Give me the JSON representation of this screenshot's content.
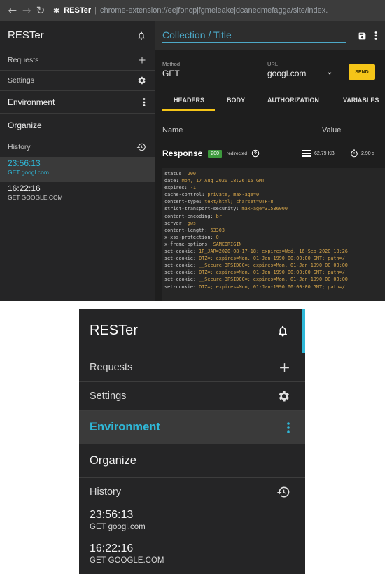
{
  "browser": {
    "back_icon": "arrow-left-icon",
    "forward_icon": "arrow-right-icon",
    "reload_icon": "reload-icon",
    "extension_icon": "puzzle-icon",
    "site_name": "RESTer",
    "url": "chrome-extension://eejfoncpjfgmeleakejdcanedmefagga/site/index."
  },
  "sidebar": {
    "title": "RESTer",
    "title_icon": "bell-icon",
    "requests_label": "Requests",
    "settings_label": "Settings",
    "environment_label": "Environment",
    "organize_label": "Organize",
    "history_label": "History",
    "history": [
      {
        "time": "23:56:13",
        "request": "GET googl.com"
      },
      {
        "time": "16:22:16",
        "request": "GET GOOGLE.COM"
      }
    ]
  },
  "request": {
    "collection_placeholder": "Collection / Title",
    "method_label": "Method",
    "method_value": "GET",
    "url_label": "URL",
    "url_value": "googl.com",
    "send_label": "SEND",
    "tabs": [
      "HEADERS",
      "BODY",
      "AUTHORIZATION",
      "VARIABLES"
    ],
    "name_label": "Name",
    "value_label": "Value"
  },
  "response": {
    "title": "Response",
    "status_code": "200",
    "redirected_label": "redirected",
    "size": "62.79 KB",
    "time": "2.90 s",
    "headers": [
      {
        "k": "status",
        "v": "200"
      },
      {
        "k": "date",
        "v": "Mon, 17 Aug 2020 18:26:15 GMT"
      },
      {
        "k": "expires",
        "v": "-1"
      },
      {
        "k": "cache-control",
        "v": "private, max-age=0"
      },
      {
        "k": "content-type",
        "v": "text/html; charset=UTF-8"
      },
      {
        "k": "strict-transport-security",
        "v": "max-age=31536000"
      },
      {
        "k": "content-encoding",
        "v": "br"
      },
      {
        "k": "server",
        "v": "gws"
      },
      {
        "k": "content-length",
        "v": "63303"
      },
      {
        "k": "x-xss-protection",
        "v": "0"
      },
      {
        "k": "x-frame-options",
        "v": "SAMEORIGIN"
      },
      {
        "k": "set-cookie",
        "v": "1P_JAR=2020-08-17-18; expires=Wed, 16-Sep-2020 18:26"
      },
      {
        "k": "set-cookie",
        "v": "OTZ=; expires=Mon, 01-Jan-1990 00:00:00 GMT; path=/"
      },
      {
        "k": "set-cookie",
        "v": "__Secure-3PSIDCC=; expires=Mon, 01-Jan-1990 00:00:00"
      },
      {
        "k": "set-cookie",
        "v": "OTZ=; expires=Mon, 01-Jan-1990 00:00:00 GMT; path=/"
      },
      {
        "k": "set-cookie",
        "v": "__Secure-3PSIDCC=; expires=Mon, 01-Jan-1990 00:00:00"
      },
      {
        "k": "set-cookie",
        "v": "OTZ=; expires=Mon, 01-Jan-1990 00:00:00 GMT; path=/"
      }
    ]
  },
  "colors": {
    "accent": "#2fb8d8",
    "send_button": "#f5c518",
    "status_ok": "#3d9a3d"
  }
}
